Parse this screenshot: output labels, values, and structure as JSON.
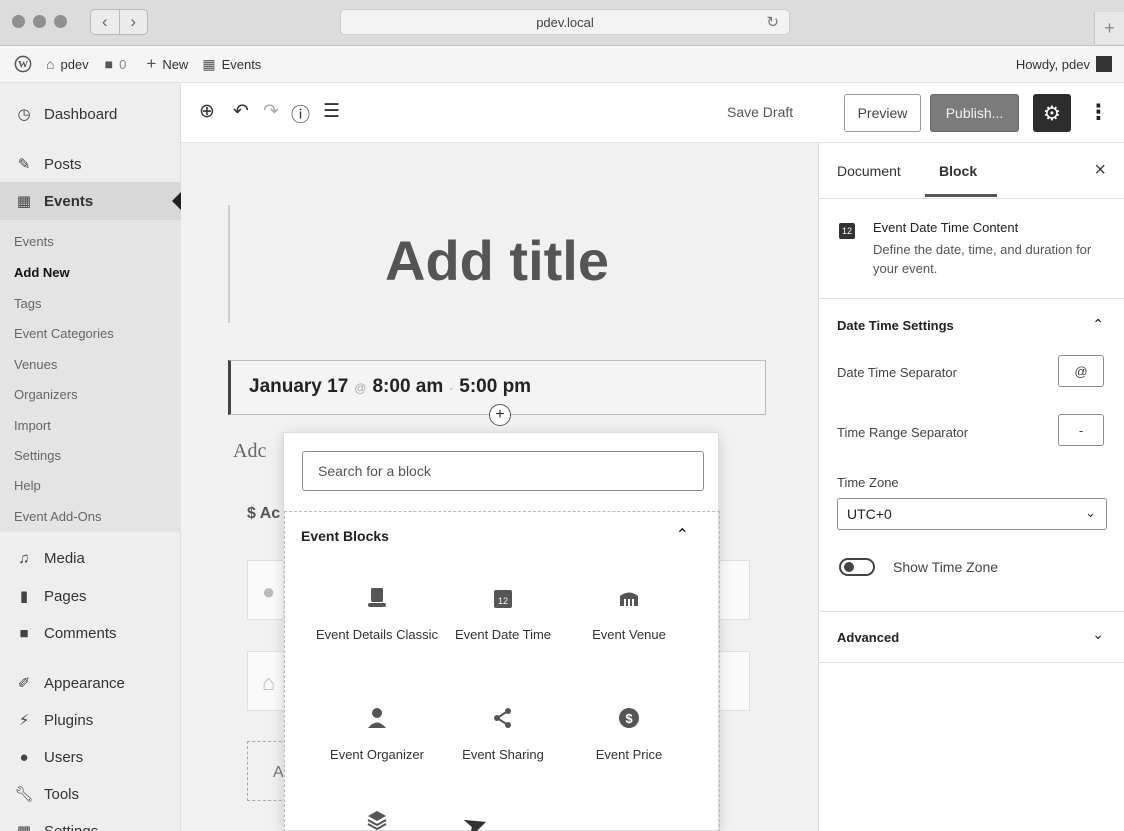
{
  "browser": {
    "url": "pdev.local",
    "back_icon": "chevron-left-icon",
    "forward_icon": "chevron-right-icon",
    "reload_icon": "reload-icon",
    "new_tab_label": "+"
  },
  "admin_bar": {
    "site_name": "pdev",
    "comment_count": "0",
    "new_label": "New",
    "events_label": "Events",
    "howdy": "Howdy, pdev"
  },
  "sidebar": {
    "items": [
      {
        "label": "Dashboard",
        "icon": "dashboard-icon"
      },
      {
        "label": "Posts",
        "icon": "pin-icon"
      },
      {
        "label": "Events",
        "icon": "calendar-icon"
      },
      {
        "label": "Media",
        "icon": "media-icon"
      },
      {
        "label": "Pages",
        "icon": "pages-icon"
      },
      {
        "label": "Comments",
        "icon": "comments-icon"
      },
      {
        "label": "Appearance",
        "icon": "brush-icon"
      },
      {
        "label": "Plugins",
        "icon": "plug-icon"
      },
      {
        "label": "Users",
        "icon": "users-icon"
      },
      {
        "label": "Tools",
        "icon": "wrench-icon"
      },
      {
        "label": "Settings",
        "icon": "settings-icon"
      }
    ],
    "events_submenu": [
      "Events",
      "Add New",
      "Tags",
      "Event Categories",
      "Venues",
      "Organizers",
      "Import",
      "Settings",
      "Help",
      "Event Add-Ons"
    ]
  },
  "toolbar": {
    "save_draft": "Save Draft",
    "preview": "Preview",
    "publish": "Publish..."
  },
  "canvas": {
    "title_placeholder": "Add title",
    "date": "January 17",
    "date_separator": "@",
    "start_time": "8:00 am",
    "time_separator": "-",
    "end_time": "5:00 pm",
    "description_partial": "Adc",
    "price_partial": "$ Ac",
    "ghost_a": "A"
  },
  "inserter": {
    "search_placeholder": "Search for a block",
    "section_title": "Event Blocks",
    "blocks": [
      {
        "label": "Event Details Classic",
        "icon": "hat-icon"
      },
      {
        "label": "Event Date Time",
        "icon": "calendar-12-icon"
      },
      {
        "label": "Event Venue",
        "icon": "venue-icon"
      },
      {
        "label": "Event Organizer",
        "icon": "person-icon"
      },
      {
        "label": "Event Sharing",
        "icon": "share-icon"
      },
      {
        "label": "Event Price",
        "icon": "dollar-icon"
      }
    ]
  },
  "settings_panel": {
    "tab_document": "Document",
    "tab_block": "Block",
    "block_title": "Event Date Time Content",
    "block_desc": "Define the date, time, and duration for your event.",
    "block_icon_text": "12",
    "section_datetime": "Date Time Settings",
    "label_dt_separator": "Date Time Separator",
    "value_dt_separator": "@",
    "label_tr_separator": "Time Range Separator",
    "value_tr_separator": "-",
    "label_timezone": "Time Zone",
    "value_timezone": "UTC+0",
    "label_show_tz": "Show Time Zone",
    "section_advanced": "Advanced"
  }
}
